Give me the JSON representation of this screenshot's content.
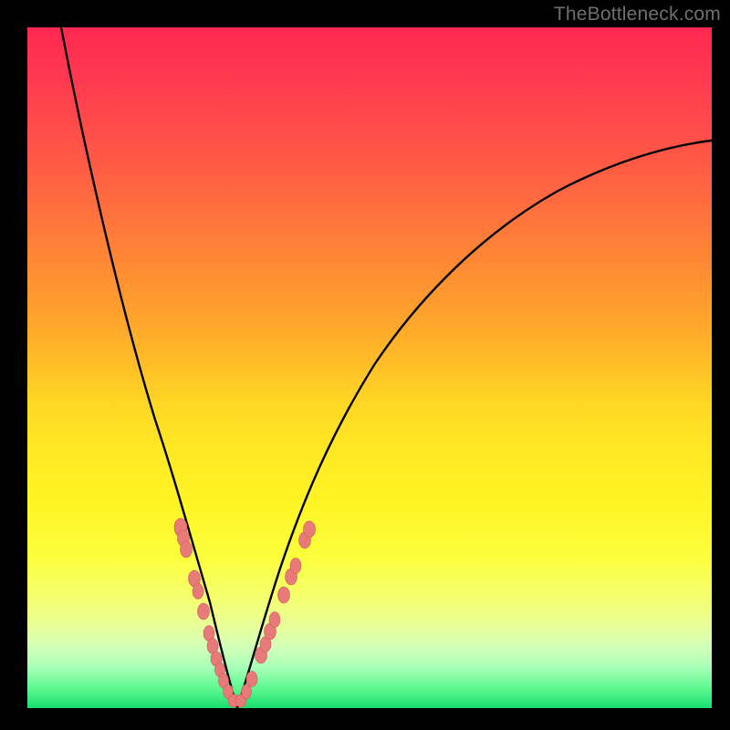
{
  "watermark": "TheBottleneck.com",
  "colors": {
    "gradient_top": "#ff2850",
    "gradient_mid": "#ffe824",
    "gradient_bottom": "#18e070",
    "curve": "#000000",
    "bead_fill": "#e97a7a",
    "bead_stroke": "#c95a5a",
    "frame": "#000000"
  },
  "chart_data": {
    "type": "line",
    "title": "",
    "xlabel": "",
    "ylabel": "",
    "xlim": [
      0,
      100
    ],
    "ylim": [
      0,
      100
    ],
    "grid": false,
    "legend": false,
    "series": [
      {
        "name": "left-branch",
        "x": [
          5,
          8,
          11,
          14,
          16,
          18,
          20,
          22,
          23,
          24,
          25,
          26,
          27,
          28,
          29,
          30
        ],
        "y": [
          100,
          84,
          70,
          57,
          48,
          40,
          33,
          26,
          22,
          18,
          14,
          11,
          8,
          5,
          3,
          1
        ]
      },
      {
        "name": "right-branch",
        "x": [
          30,
          32,
          34,
          36,
          38,
          40,
          44,
          48,
          54,
          60,
          68,
          76,
          84,
          92,
          100
        ],
        "y": [
          1,
          6,
          12,
          18,
          24,
          30,
          40,
          48,
          58,
          65,
          72,
          77,
          80,
          82,
          83
        ]
      }
    ],
    "markers": [
      {
        "series": "left-branch",
        "x": 22,
        "y": 26
      },
      {
        "series": "left-branch",
        "x": 22.5,
        "y": 24
      },
      {
        "series": "left-branch",
        "x": 23,
        "y": 22
      },
      {
        "series": "left-branch",
        "x": 24.5,
        "y": 16
      },
      {
        "series": "left-branch",
        "x": 25,
        "y": 14
      },
      {
        "series": "left-branch",
        "x": 26,
        "y": 11
      },
      {
        "series": "left-branch",
        "x": 27,
        "y": 8
      },
      {
        "series": "left-branch",
        "x": 27.5,
        "y": 6.5
      },
      {
        "series": "left-branch",
        "x": 28,
        "y": 5
      },
      {
        "series": "left-branch",
        "x": 28.5,
        "y": 4
      },
      {
        "series": "left-branch",
        "x": 29,
        "y": 3
      },
      {
        "series": "left-branch",
        "x": 29.5,
        "y": 2
      },
      {
        "series": "left-branch",
        "x": 30,
        "y": 1
      },
      {
        "series": "right-branch",
        "x": 30.5,
        "y": 1.5
      },
      {
        "series": "right-branch",
        "x": 31,
        "y": 2.5
      },
      {
        "series": "right-branch",
        "x": 31.5,
        "y": 4
      },
      {
        "series": "right-branch",
        "x": 33,
        "y": 8
      },
      {
        "series": "right-branch",
        "x": 33.5,
        "y": 10
      },
      {
        "series": "right-branch",
        "x": 34,
        "y": 12
      },
      {
        "series": "right-branch",
        "x": 34.5,
        "y": 14
      },
      {
        "series": "right-branch",
        "x": 36,
        "y": 18
      },
      {
        "series": "right-branch",
        "x": 37,
        "y": 21
      },
      {
        "series": "right-branch",
        "x": 37.5,
        "y": 23
      },
      {
        "series": "right-branch",
        "x": 39,
        "y": 27
      },
      {
        "series": "right-branch",
        "x": 39.5,
        "y": 29
      }
    ]
  }
}
